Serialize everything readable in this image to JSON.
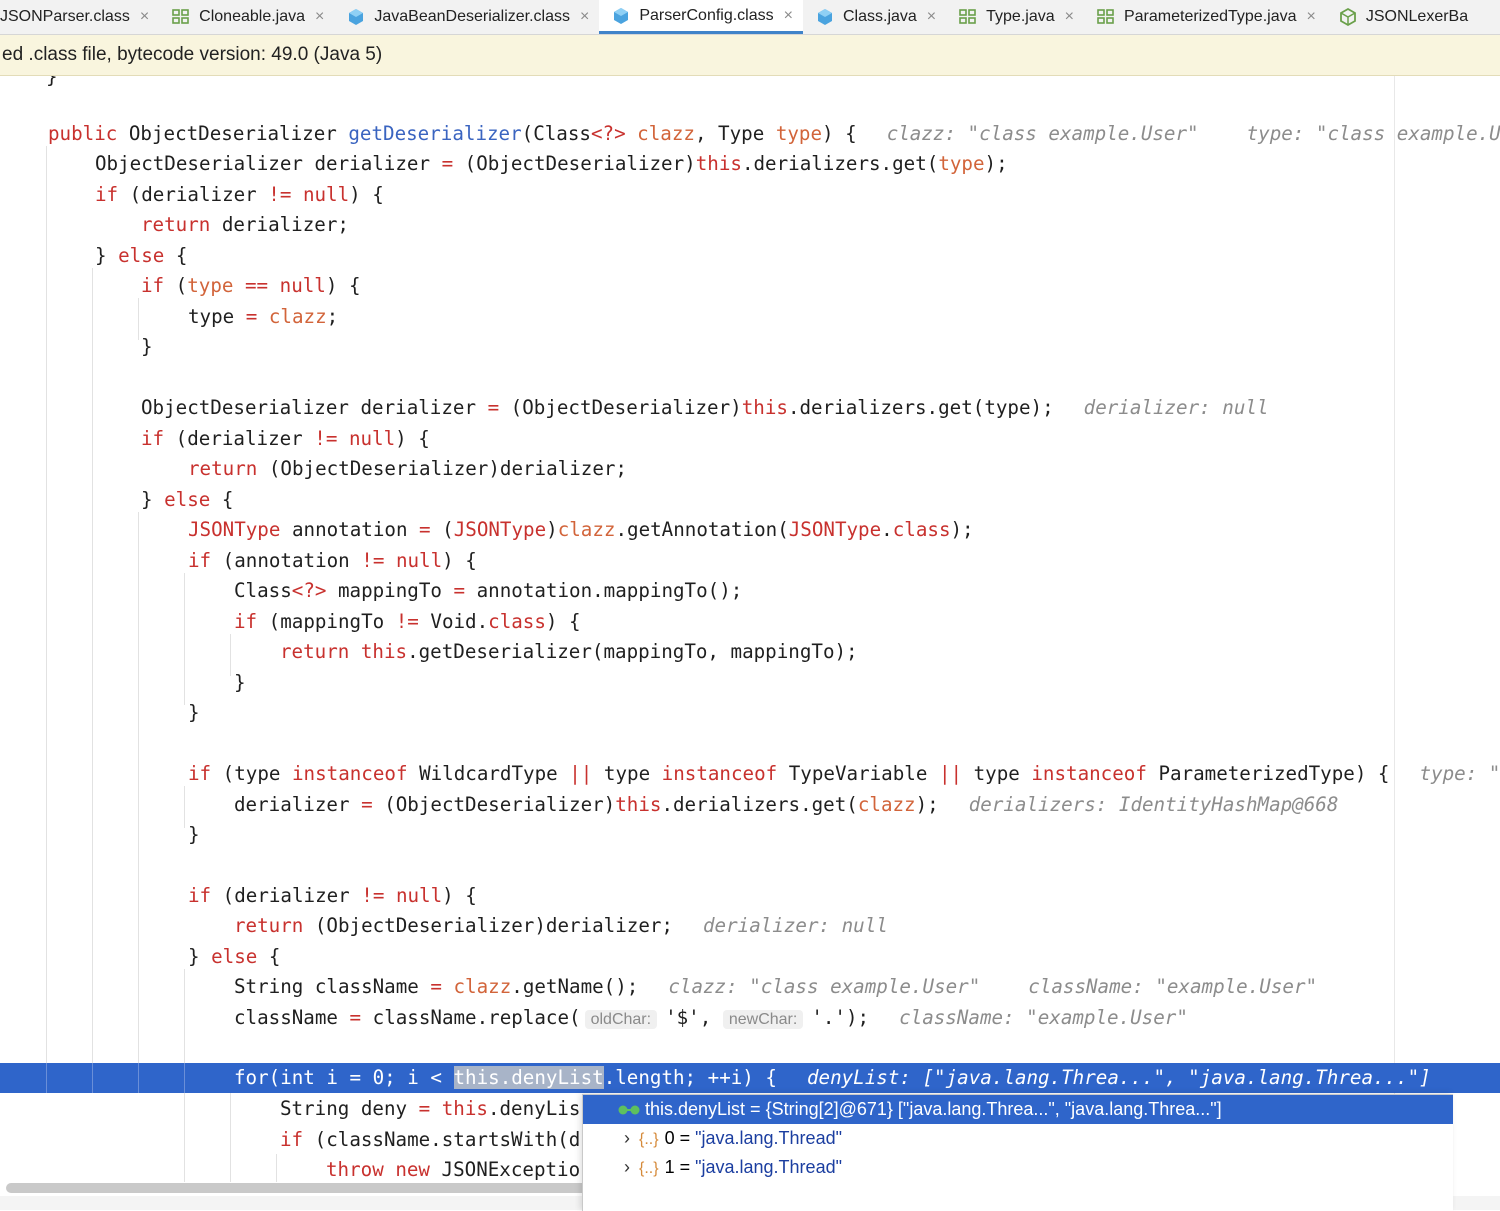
{
  "tabs": [
    {
      "label": "JSONParser.class",
      "icon": "class-icon",
      "active": false
    },
    {
      "label": "Cloneable.java",
      "icon": "interface-icon",
      "active": false
    },
    {
      "label": "JavaBeanDeserializer.class",
      "icon": "class-icon",
      "active": false
    },
    {
      "label": "ParserConfig.class",
      "icon": "class-icon",
      "active": true
    },
    {
      "label": "Class.java",
      "icon": "class-icon",
      "active": false
    },
    {
      "label": "Type.java",
      "icon": "interface-icon",
      "active": false
    },
    {
      "label": "ParameterizedType.java",
      "icon": "interface-icon",
      "active": false
    },
    {
      "label": "JSONLexerBa",
      "icon": "abstract-class-icon",
      "active": false
    }
  ],
  "banner": {
    "text": "ed .class file, bytecode version: 49.0 (Java 5)"
  },
  "close_glyph": "×",
  "code": {
    "l2": {
      "t1": "public ",
      "t2": "ObjectDeserializer ",
      "t3": "getDeserializer",
      "t4": "(Class",
      "t5": "<?>",
      "t6": " clazz",
      "t7": ", Type ",
      "t8": "type",
      "t9": ") {",
      "h1": "clazz: \"class example.User\"",
      "h2": "type: \"class example.U"
    },
    "l3": {
      "t1": "ObjectDeserializer derializer ",
      "t2": "=",
      "t3": " (ObjectDeserializer)",
      "t4": "this",
      "t5": ".derializers.get(",
      "t6": "type",
      "t7": ");"
    },
    "l4": {
      "t1": "if",
      "t2": " (derializer ",
      "t3": "!=",
      "t4": " null",
      "t5": ") {"
    },
    "l5": {
      "t1": "return",
      "t2": " derializer;"
    },
    "l6": {
      "t1": "} ",
      "t2": "else",
      "t3": " {"
    },
    "l7": {
      "t1": "if",
      "t2": " (",
      "t3": "type",
      "t4": " ==",
      "t5": " null",
      "t6": ") {"
    },
    "l8": {
      "t1": "type ",
      "t2": "=",
      "t3": " clazz",
      "t4": ";"
    },
    "l9": {
      "t1": "}"
    },
    "l11": {
      "t1": "ObjectDeserializer derializer ",
      "t2": "=",
      "t3": " (ObjectDeserializer)",
      "t4": "this",
      "t5": ".derializers.get(type);",
      "h1": "derializer: null"
    },
    "l12": {
      "t1": "if",
      "t2": " (derializer ",
      "t3": "!=",
      "t4": " null",
      "t5": ") {"
    },
    "l13": {
      "t1": "return",
      "t2": " (ObjectDeserializer)derializer;"
    },
    "l14": {
      "t1": "} ",
      "t2": "else",
      "t3": " {"
    },
    "l15": {
      "t1": "JSONType",
      "t2": " annotation ",
      "t3": "=",
      "t4": " (",
      "t5": "JSONType",
      "t6": ")",
      "t7": "clazz",
      "t8": ".getAnnotation(",
      "t9": "JSONType",
      "t10": ".",
      "t11": "class",
      "t12": ");"
    },
    "l16": {
      "t1": "if",
      "t2": " (annotation ",
      "t3": "!=",
      "t4": " null",
      "t5": ") {"
    },
    "l17": {
      "t1": "Class",
      "t2": "<?>",
      "t3": " mappingTo ",
      "t4": "=",
      "t5": " annotation.mappingTo();"
    },
    "l18": {
      "t1": "if",
      "t2": " (mappingTo ",
      "t3": "!=",
      "t4": " Void.",
      "t5": "class",
      "t6": ") {"
    },
    "l19": {
      "t1": "return",
      "t2": " this",
      "t3": ".getDeserializer(mappingTo, mappingTo);"
    },
    "l20": {
      "t1": "}"
    },
    "l21": {
      "t1": "}"
    },
    "l23": {
      "t1": "if",
      "t2": " (type ",
      "t3": "instanceof",
      "t4": " WildcardType ",
      "t5": "||",
      "t6": " type ",
      "t7": "instanceof",
      "t8": " TypeVariable ",
      "t9": "||",
      "t10": " type ",
      "t11": "instanceof",
      "t12": " ParameterizedType) {",
      "h1": "type: \""
    },
    "l24": {
      "t1": "derializer ",
      "t2": "=",
      "t3": " (ObjectDeserializer)",
      "t4": "this",
      "t5": ".derializers.get(",
      "t6": "clazz",
      "t7": ");",
      "h1": "derializers: IdentityHashMap@668"
    },
    "l25": {
      "t1": "}"
    },
    "l27": {
      "t1": "if",
      "t2": " (derializer ",
      "t3": "!=",
      "t4": " null",
      "t5": ") {"
    },
    "l28": {
      "t1": "return",
      "t2": " (ObjectDeserializer)derializer;",
      "h1": "derializer: null"
    },
    "l29": {
      "t1": "} ",
      "t2": "else",
      "t3": " {"
    },
    "l30": {
      "t1": "String className ",
      "t2": "=",
      "t3": " clazz",
      "t4": ".getName();",
      "h1": "clazz: \"class example.User\"",
      "h2": "className: \"example.User\""
    },
    "l31": {
      "t1": "className ",
      "t2": "=",
      "t3": " className.replace(",
      "p1": "oldChar:",
      "t4": "'$'",
      "t5": ", ",
      "p2": "newChar:",
      "t6": "'.'",
      "t7": ");",
      "h1": "className: \"example.User\""
    },
    "l33": {
      "t1": "for(int i = 0; i < ",
      "t2": "this.denyList",
      "t3": ".length; ++i) {",
      "h1": "denyList: [\"java.lang.Threa...\", \"java.lang.Threa...\"]"
    },
    "l34": {
      "t1": "String deny ",
      "t2": "=",
      "t3": " this",
      "t4": ".denyLis"
    },
    "l35": {
      "t1": "if",
      "t2": " (className.startsWith(d"
    },
    "l36": {
      "t1": "throw",
      "t2": " new",
      "t3": " JSONExceptio"
    }
  },
  "popup": {
    "root": "this.denyList = {String[2]@671} [\"java.lang.Threa...\", \"java.lang.Threa...\"]",
    "items": [
      {
        "index": "0",
        "eq": " = ",
        "value": "\"java.lang.Thread\""
      },
      {
        "index": "1",
        "eq": " = ",
        "value": "\"java.lang.Thread\""
      }
    ],
    "chevron": "›",
    "array_icon": "{..}"
  },
  "colors": {
    "keyword": "#c8312e",
    "method": "#3a64c0",
    "param": "#d2643a",
    "hint": "#8c8c8c",
    "selection": "#2f65ca",
    "banner": "#f9f5de"
  }
}
